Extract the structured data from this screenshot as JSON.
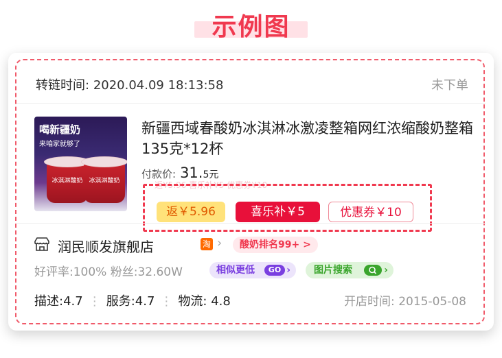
{
  "page_title": "示例图",
  "header": {
    "time_label": "转链时间:",
    "time_value": "2020.04.09 18:13:58",
    "status": "未下单"
  },
  "product": {
    "image_badge": "喝新疆奶",
    "image_sub": "来咱家就够了",
    "cup_text": "冰淇淋酸奶",
    "name": "新疆西域春酸奶冰淇淋冰激凌整箱网红浓缩酸奶整箱135克*12杯",
    "price_label": "付款价:",
    "price_value": "31.",
    "price_decimal": "5",
    "price_unit": "元",
    "ghost_text": "返¥5.96  喜乐补¥5  优惠券¥10"
  },
  "tags": {
    "rebate": "返￥5.96",
    "xilebu": "喜乐补￥5",
    "coupon": "优惠券￥10"
  },
  "shop": {
    "name": "润民顺发旗舰店",
    "platform_badge": "淘",
    "rank_badge": "酸奶排名99+ >",
    "stats": "好评率:100%  粉丝:32.60W",
    "similar_label": "相似更低",
    "similar_go": "GO",
    "image_search_label": "图片搜索"
  },
  "ratings": {
    "describe": "描述:4.7",
    "service": "服务:4.7",
    "logistics": "物流: 4.8",
    "open_time": "开店时间: 2015-05-08"
  },
  "colors": {
    "accent": "#f0394f",
    "rebate_bg": "#ffe27a",
    "similar": "#7a3fe0",
    "image_search": "#3aa52c"
  }
}
